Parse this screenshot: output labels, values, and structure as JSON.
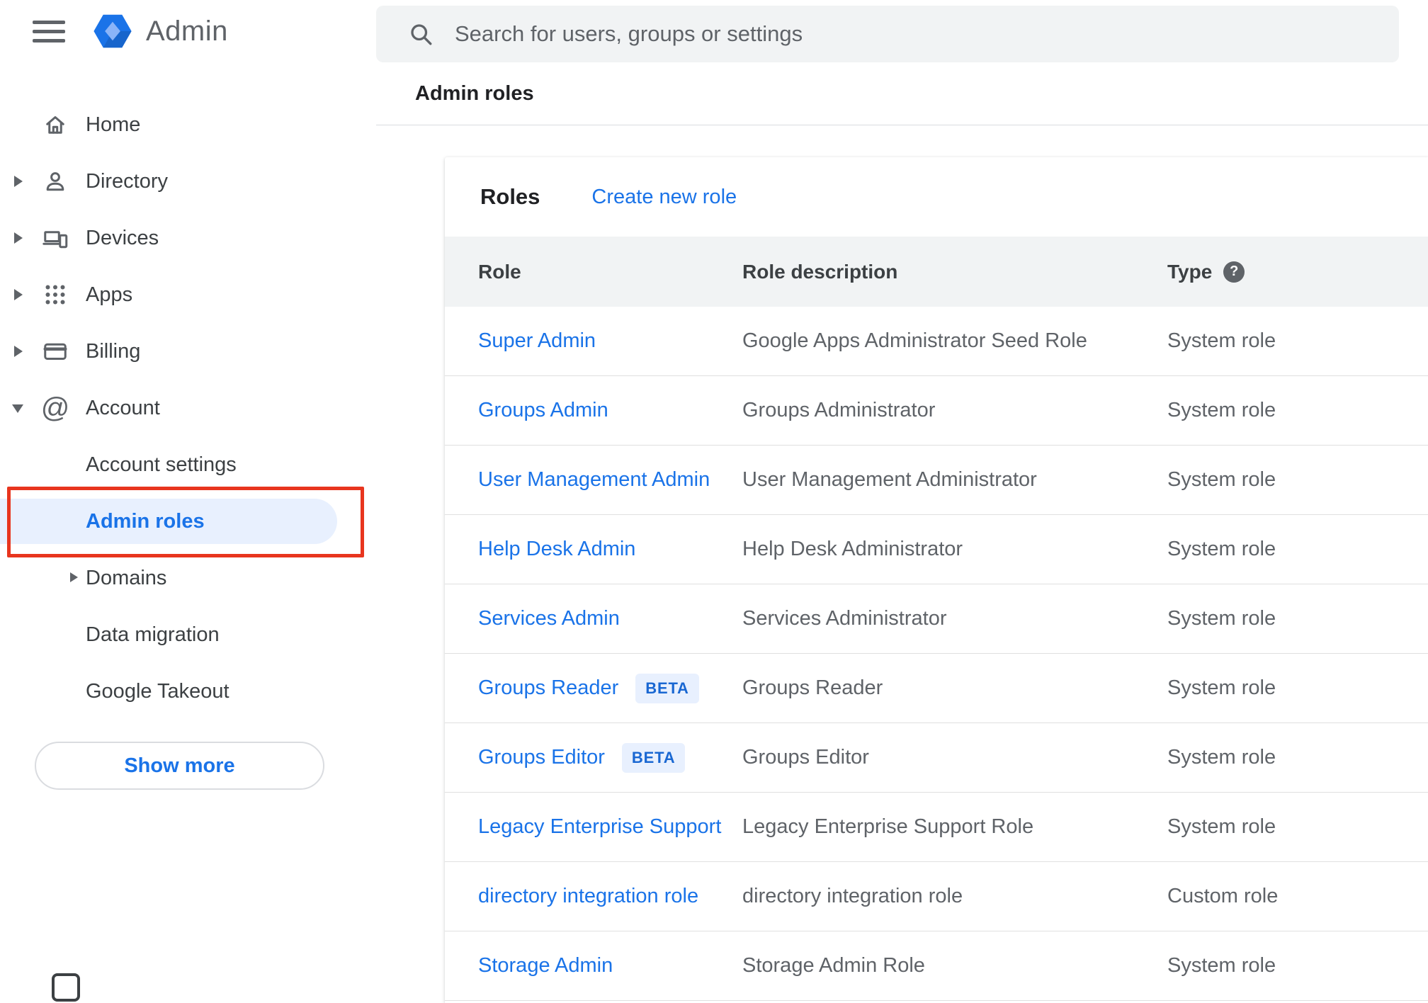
{
  "app": {
    "name": "Admin"
  },
  "search": {
    "placeholder": "Search for users, groups or settings"
  },
  "breadcrumb": {
    "label": "Admin roles"
  },
  "sidebar": {
    "items": [
      {
        "label": "Home"
      },
      {
        "label": "Directory"
      },
      {
        "label": "Devices"
      },
      {
        "label": "Apps"
      },
      {
        "label": "Billing"
      },
      {
        "label": "Account"
      }
    ],
    "account_children": [
      {
        "label": "Account settings"
      },
      {
        "label": "Admin roles",
        "selected": true
      },
      {
        "label": "Domains"
      },
      {
        "label": "Data migration"
      },
      {
        "label": "Google Takeout"
      }
    ],
    "show_more_label": "Show more"
  },
  "main": {
    "title": "Roles",
    "create_new_role_label": "Create new role",
    "table": {
      "headers": {
        "role": "Role",
        "description": "Role description",
        "type": "Type"
      },
      "beta_badge_label": "BETA",
      "rows": [
        {
          "role": "Super Admin",
          "beta": false,
          "description": "Google Apps Administrator Seed Role",
          "type": "System role"
        },
        {
          "role": "Groups Admin",
          "beta": false,
          "description": "Groups Administrator",
          "type": "System role"
        },
        {
          "role": "User Management Admin",
          "beta": false,
          "description": "User Management Administrator",
          "type": "System role"
        },
        {
          "role": "Help Desk Admin",
          "beta": false,
          "description": "Help Desk Administrator",
          "type": "System role"
        },
        {
          "role": "Services Admin",
          "beta": false,
          "description": "Services Administrator",
          "type": "System role"
        },
        {
          "role": "Groups Reader",
          "beta": true,
          "description": "Groups Reader",
          "type": "System role"
        },
        {
          "role": "Groups Editor",
          "beta": true,
          "description": "Groups Editor",
          "type": "System role"
        },
        {
          "role": "Legacy Enterprise Support",
          "beta": false,
          "description": "Legacy Enterprise Support Role",
          "type": "System role"
        },
        {
          "role": "directory integration role",
          "beta": false,
          "description": "directory integration role",
          "type": "Custom role"
        },
        {
          "role": "Storage Admin",
          "beta": false,
          "description": "Storage Admin Role",
          "type": "System role"
        }
      ]
    }
  },
  "annotation": {
    "color": "#e8351e"
  },
  "colors": {
    "accent_blue": "#1a73e8",
    "selected_item_bg": "#e8f0fe",
    "table_header_bg": "#f1f3f4",
    "text_primary": "#202124",
    "text_secondary": "#5f6368",
    "divider": "#e0e0e0"
  }
}
